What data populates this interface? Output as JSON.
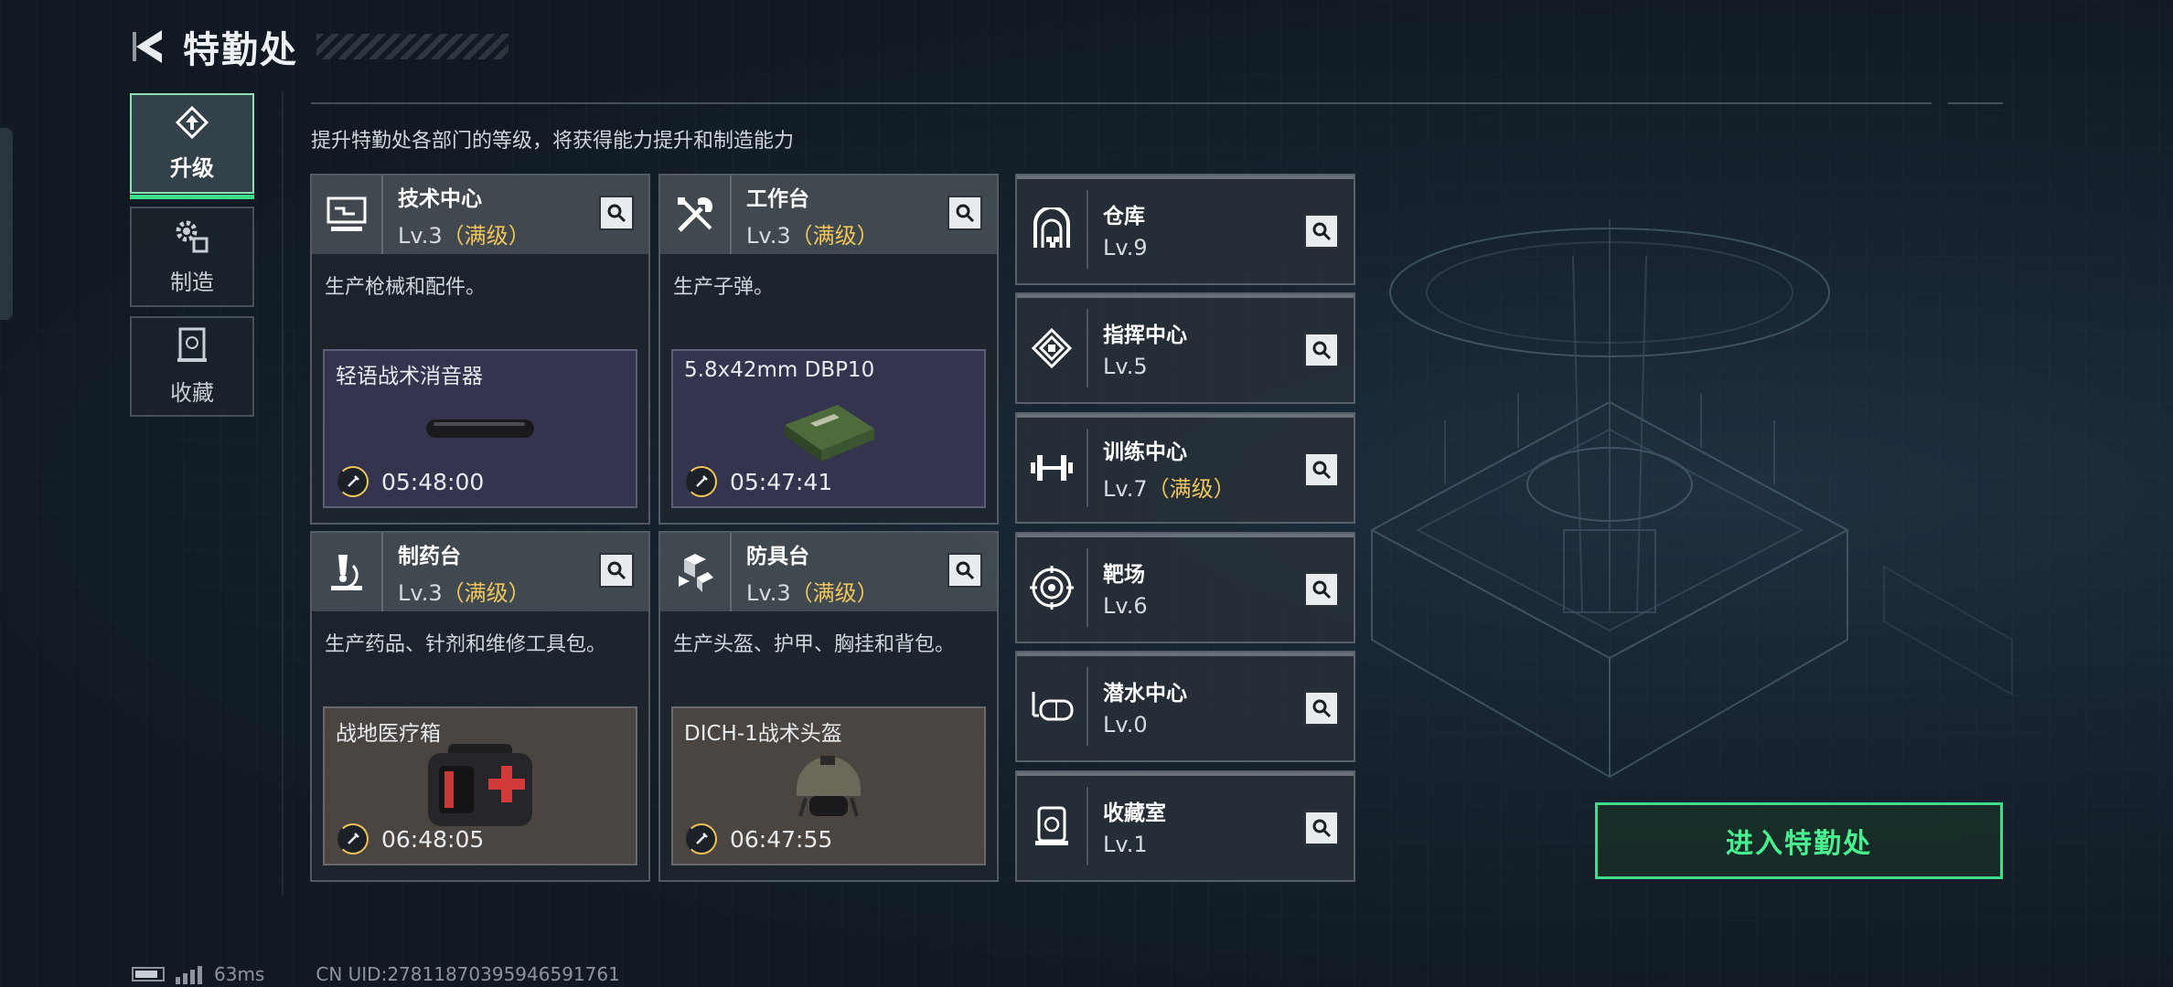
{
  "header": {
    "title": "特勤处",
    "back_icon": "back-arrow-icon"
  },
  "tabs": [
    {
      "label": "升级",
      "icon": "upgrade-icon",
      "active": true
    },
    {
      "label": "制造",
      "icon": "gears-icon",
      "active": false
    },
    {
      "label": "收藏",
      "icon": "collection-icon",
      "active": false
    }
  ],
  "description": "提升特勤处各部门的等级，将获得能力提升和制造能力",
  "departments": [
    {
      "name": "技术中心",
      "level": "Lv.3",
      "maxed": "（满级）",
      "icon": "computer-icon",
      "desc": "生产枪械和配件。",
      "craft_item": "轻语战术消音器",
      "craft_timer": "05:48:00",
      "craft_bg": "purple"
    },
    {
      "name": "工作台",
      "level": "Lv.3",
      "maxed": "（满级）",
      "icon": "tools-icon",
      "desc": "生产子弹。",
      "craft_item": "5.8x42mm DBP10",
      "craft_timer": "05:47:41",
      "craft_bg": "purple"
    },
    {
      "name": "制药台",
      "level": "Lv.3",
      "maxed": "（满级）",
      "icon": "microscope-icon",
      "desc": "生产药品、针剂和维修工具包。",
      "craft_item": "战地医疗箱",
      "craft_timer": "06:48:05",
      "craft_bg": "brown"
    },
    {
      "name": "防具台",
      "level": "Lv.3",
      "maxed": "（满级）",
      "icon": "armor-blocks-icon",
      "desc": "生产头盔、护甲、胸挂和背包。",
      "craft_item": "DICH-1战术头盔",
      "craft_timer": "06:47:55",
      "craft_bg": "brown"
    }
  ],
  "facilities": [
    {
      "name": "仓库",
      "level": "Lv.9",
      "maxed": "",
      "icon": "warehouse-icon"
    },
    {
      "name": "指挥中心",
      "level": "Lv.5",
      "maxed": "",
      "icon": "command-chip-icon"
    },
    {
      "name": "训练中心",
      "level": "Lv.7",
      "maxed": "（满级）",
      "icon": "dumbbell-icon"
    },
    {
      "name": "靶场",
      "level": "Lv.6",
      "maxed": "",
      "icon": "target-icon"
    },
    {
      "name": "潜水中心",
      "level": "Lv.0",
      "maxed": "",
      "icon": "diving-mask-icon"
    },
    {
      "name": "收藏室",
      "level": "Lv.1",
      "maxed": "",
      "icon": "collection-room-icon"
    }
  ],
  "enter_button": "进入特勤处",
  "status": {
    "ping": "63ms",
    "uid": "CN UID:27811870395946591761"
  },
  "colors": {
    "accent_green": "#3fdc8a",
    "maxed_gold": "#f0c55a",
    "purple_slot": "#34344f",
    "brown_slot": "#4a4540"
  }
}
